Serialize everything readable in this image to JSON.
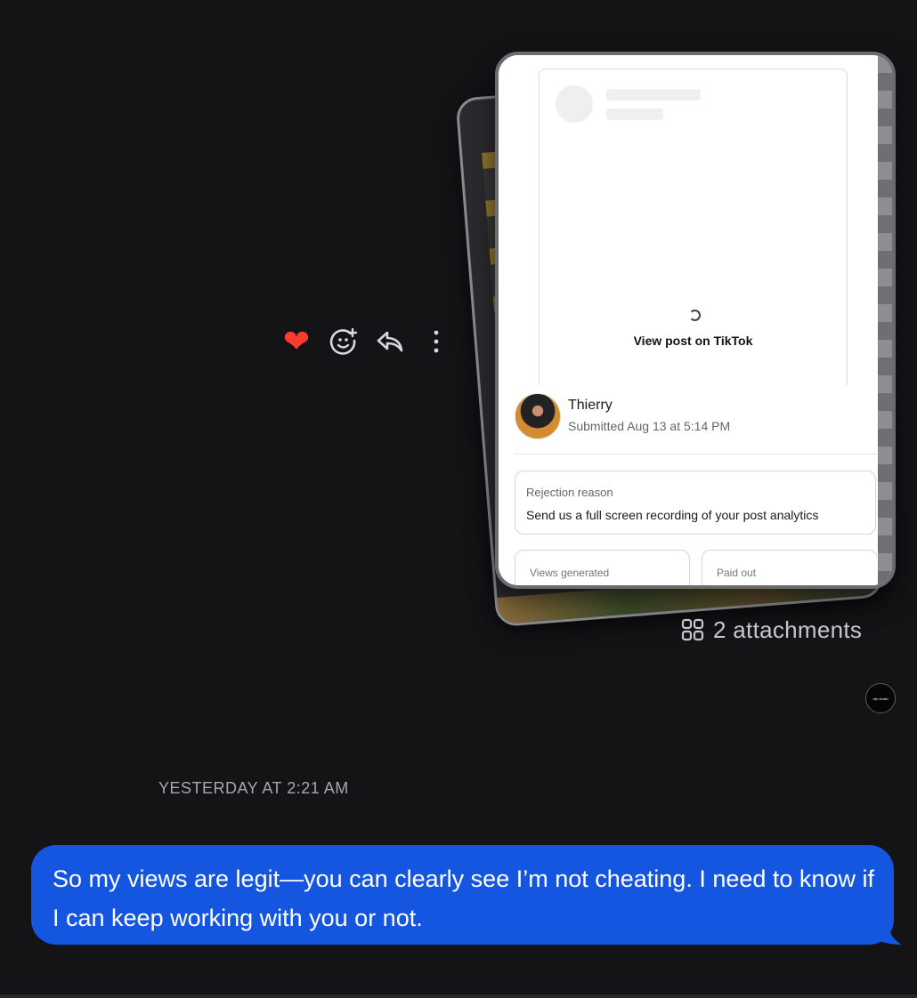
{
  "message_actions": {
    "heart": "❤",
    "add_reaction_icon": "emoji-add-icon",
    "reply_icon": "reply-icon",
    "more_icon": "more-vertical-icon"
  },
  "attachment_preview": {
    "embed_link": "View post on TikTok",
    "submitter_name": "Thierry",
    "submitted_text": "Submitted Aug 13 at 5:14 PM",
    "rejection_label": "Rejection reason",
    "rejection_text": "Send us a full screen recording of your post analytics",
    "stats": [
      "Views generated",
      "Paid out"
    ]
  },
  "attachments_label": "2 attachments",
  "sender_avatar_text": "clip smart",
  "timestamp": "YESTERDAY AT 2:21 AM",
  "message": {
    "text": "So my views are legit—you can clearly see I’m not cheating. I need to know if I can keep working with you or not."
  },
  "colors": {
    "background": "#141316",
    "bubble": "#1456e0",
    "heart": "#ff3b30"
  }
}
